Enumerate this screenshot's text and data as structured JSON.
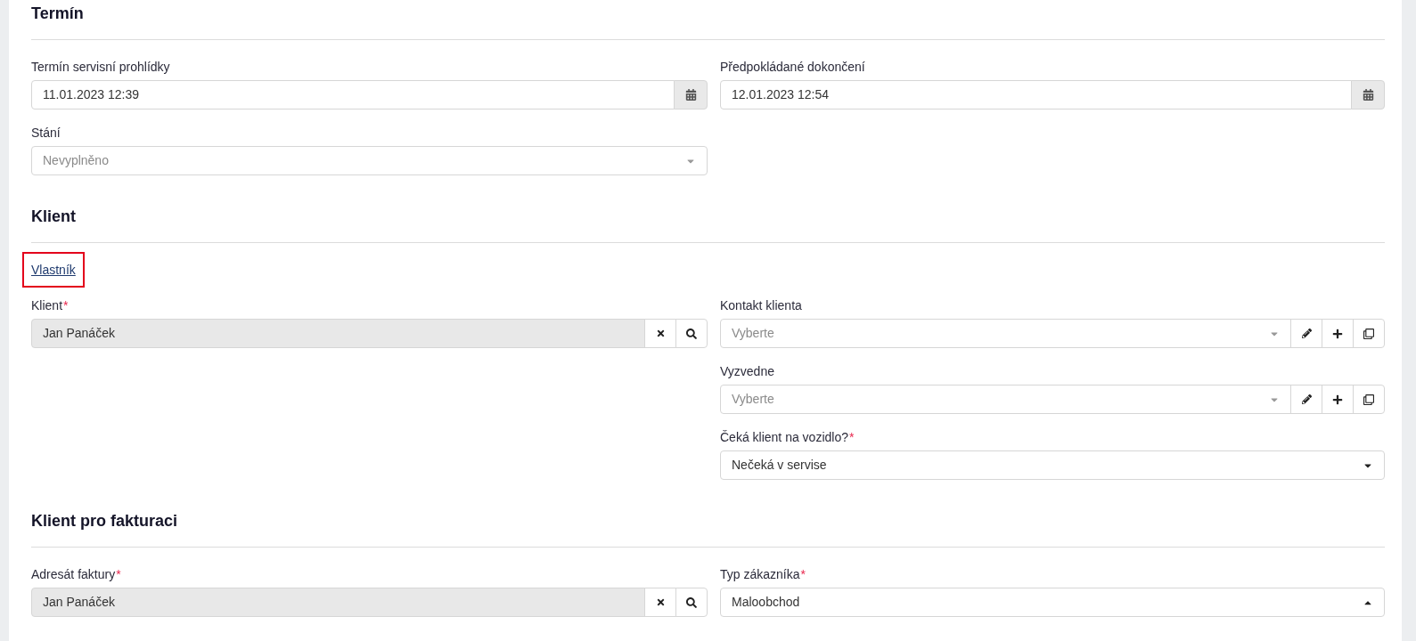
{
  "sections": [
    {
      "title": "Termín",
      "left": [
        {
          "kind": "date",
          "label": "Termín servisní prohlídky",
          "value": "11.01.2023 12:39"
        },
        {
          "kind": "select",
          "label": "Stání",
          "placeholder": "Nevyplněno",
          "open": false
        }
      ],
      "right": [
        {
          "kind": "date",
          "label": "Předpokládané dokončení",
          "value": "12.01.2023 12:54"
        }
      ]
    },
    {
      "title": "Klient",
      "link": {
        "text": "Vlastník",
        "highlighted": true
      },
      "left": [
        {
          "kind": "lookup",
          "label": "Klient",
          "required_mark": "*",
          "value": "Jan Panáček"
        }
      ],
      "right": [
        {
          "kind": "combo",
          "label": "Kontakt klienta",
          "placeholder": "Vyberte"
        },
        {
          "kind": "combo",
          "label": "Vyzvedne",
          "placeholder": "Vyberte"
        },
        {
          "kind": "select",
          "label": "Čeká klient na vozidlo?",
          "required_mark": "*",
          "value": "Nečeká v servise",
          "open": false
        }
      ]
    },
    {
      "title": "Klient pro fakturaci",
      "left": [
        {
          "kind": "lookup",
          "label": "Adresát faktury",
          "required_mark": "*",
          "value": "Jan Panáček"
        }
      ],
      "right": [
        {
          "kind": "select",
          "label": "Typ zákazníka",
          "required_mark": "*",
          "value": "Maloobchod",
          "open": true
        }
      ]
    }
  ]
}
